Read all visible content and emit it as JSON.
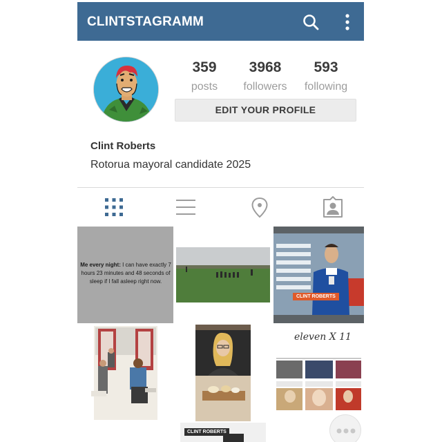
{
  "app": {
    "title": "CLINTSTAGRAMM"
  },
  "profile": {
    "name": "Clint Roberts",
    "bio": "Rotorua mayoral candidate 2025",
    "edit_label": "EDIT YOUR PROFILE"
  },
  "stats": {
    "posts": {
      "value": "359",
      "label": "posts"
    },
    "followers": {
      "value": "3968",
      "label": "followers"
    },
    "following": {
      "value": "593",
      "label": "following"
    }
  },
  "tabs": [
    {
      "icon": "grid-icon",
      "active": true
    },
    {
      "icon": "list-icon",
      "active": false
    },
    {
      "icon": "location-pin-icon",
      "active": false
    },
    {
      "icon": "tagged-person-icon",
      "active": false
    }
  ],
  "posts": {
    "meme": {
      "lead": "Me every night:",
      "rest": " I can have exactly 7 hours 23 minutes and 48 seconds of sleep if I fall asleep right now."
    },
    "tv_caption": "CLINT ROBERTS",
    "magazine_title": "eleven X 11",
    "label_strip": "CLINT ROBERTS"
  },
  "colors": {
    "appbar": "#3e6a93",
    "active_tab": "#3e6a93",
    "inactive_tab": "#9c9c9c"
  }
}
